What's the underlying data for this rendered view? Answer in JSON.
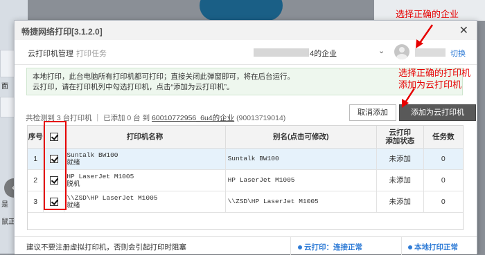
{
  "background": {
    "left_text_1": "面",
    "left_text_2": "是",
    "left_text_3": "鼠正在"
  },
  "dialog": {
    "title": "畅捷网络打印[3.1.2.0]",
    "close_glyph": "✕",
    "tabs": [
      "云打印机管理",
      "打印任务"
    ],
    "company_suffix": "4的企业",
    "switch_label": "切换"
  },
  "notice": {
    "line1": "本地打印，此台电脑所有打印机都可打印；直接关闭此弹窗即可，将在后台运行。",
    "line2": "云打印，请在打印机列中勾选打印机，点击“添加为云打印机”。"
  },
  "stats": {
    "prefix": "共检测到 3 台打印机 ｜ 已添加 0 台 到",
    "link": "60010772956_6u4的企业",
    "suffix": "(90013719014)"
  },
  "buttons": {
    "cancel": "取消添加",
    "add": "添加为云打印机"
  },
  "table": {
    "headers": {
      "index": "序号",
      "name": "打印机名称",
      "alias": "别名(点击可修改)",
      "status_line1": "云打印",
      "status_line2": "添加状态",
      "tasks": "任务数"
    },
    "rows": [
      {
        "index": "1",
        "name": "Suntalk BW100",
        "state": "就绪",
        "alias": "Suntalk BW100",
        "status": "未添加",
        "tasks": "0"
      },
      {
        "index": "2",
        "name": "HP LaserJet M1005",
        "state": "脱机",
        "alias": "HP LaserJet M1005",
        "status": "未添加",
        "tasks": "0"
      },
      {
        "index": "3",
        "name": "\\\\ZSD\\HP LaserJet M1005",
        "state": "就绪",
        "alias": "\\\\ZSD\\HP LaserJet M1005",
        "status": "未添加",
        "tasks": "0"
      }
    ]
  },
  "footer": {
    "note": "建议不要注册虚拟打印机，否则会引起打印时阻塞",
    "cloud_status": "云打印：连接正常",
    "local_status": "本地打印正常"
  },
  "annotations": {
    "select_company": "选择正确的企业",
    "select_printer_line1": "选择正确的打印机",
    "select_printer_line2": "添加为云打印机"
  },
  "colors": {
    "annotation": "#e60000",
    "status_blue": "#2e7bd6",
    "primary_button": "#595959"
  }
}
